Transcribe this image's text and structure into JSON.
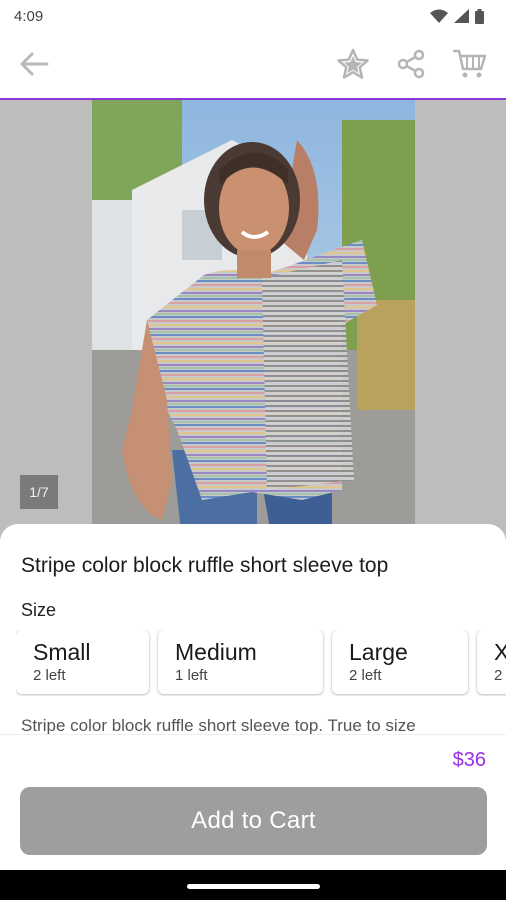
{
  "status_bar": {
    "time": "4:09"
  },
  "product": {
    "title": "Stripe color block ruffle short sleeve top",
    "image_counter": "1/7",
    "size_label": "Size",
    "sizes": [
      {
        "name": "Small",
        "stock": "2 left"
      },
      {
        "name": "Medium",
        "stock": "1 left"
      },
      {
        "name": "Large",
        "stock": "2 left"
      },
      {
        "name": "X",
        "stock": "2"
      }
    ],
    "description": "Stripe color block ruffle short sleeve top. True to size",
    "price": "$36"
  },
  "actions": {
    "add_to_cart_label": "Add to Cart"
  },
  "icons": {
    "back": "arrow-left-icon",
    "favorite": "star-icon",
    "share": "share-icon",
    "cart": "cart-icon"
  },
  "colors": {
    "accent": "#8e35e0",
    "price": "#9a2fe6",
    "button_disabled": "#9e9e9e"
  }
}
